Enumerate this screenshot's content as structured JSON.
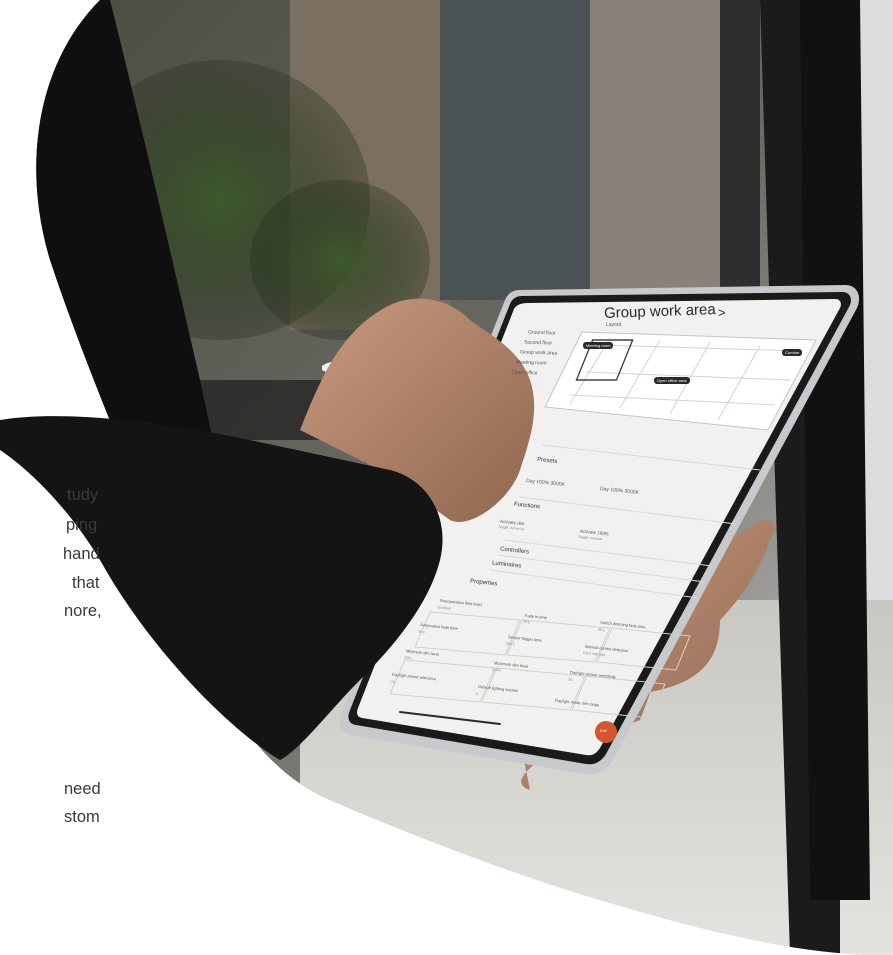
{
  "app_header": {
    "title": "Group work area",
    "title_suffix": ">"
  },
  "sidebar": {
    "items": [
      "Ground floor",
      "Second floor",
      "Group work area",
      "Meeting room",
      "Open office"
    ]
  },
  "layout_section": {
    "label": "Layout"
  },
  "map_tags": {
    "tag_a": "Meeting room",
    "tag_b": "Open office area",
    "tag_c": "Corridor"
  },
  "sections": {
    "presets": "Presets",
    "functions": "Functions",
    "controllers": "Controllers",
    "luminaires": "Luminaires",
    "properties": "Properties"
  },
  "presets": {
    "preset_1": "Day 100% 3000K",
    "preset_2": "Day 100% 3000K"
  },
  "functions": {
    "fn_1": "Activate dim",
    "fn_1_sub": "Toggle: Active on",
    "fn_2": "Activate 100%",
    "fn_2_sub": "Toggle: Inactive"
  },
  "properties": {
    "p1": "Nonoperation field level",
    "p1_v": "Enabled",
    "p2": "Fade in time",
    "p2_v": "10 s",
    "p3": "Switch dimming fade time",
    "p3_v": "00 s",
    "p4": "Automation fade time",
    "p4_v": "30 s",
    "p5": "Sensor trigger time",
    "p5_v": "900 s",
    "p6": "Manual control detection",
    "p6_v": "Don't interrupt",
    "p7": "Minimum dim level",
    "p7_v": "10%",
    "p8": "Maximum dim level",
    "p8_v": "100%",
    "p9": "Daylight sensor sensitivity",
    "p9_v": "3%",
    "p10": "Daylight preset tolerance",
    "p10_v": "1%",
    "p11": "Default lighting scenes",
    "p11_v": "0",
    "p12": "Daylight mode dim range",
    "p12_v": ""
  },
  "fab": {
    "label": "Edit"
  },
  "side_text": {
    "frag_1": "tudy",
    "frag_2": "ping",
    "frag_3": "hand",
    "frag_4": "that",
    "frag_5": "nore,",
    "frag_6": "need",
    "frag_7": "stom"
  },
  "colors": {
    "accent": "#d2572f",
    "screen_bg": "#f3f1ef",
    "sleeve": "#141414",
    "skin": "#b88d73"
  }
}
